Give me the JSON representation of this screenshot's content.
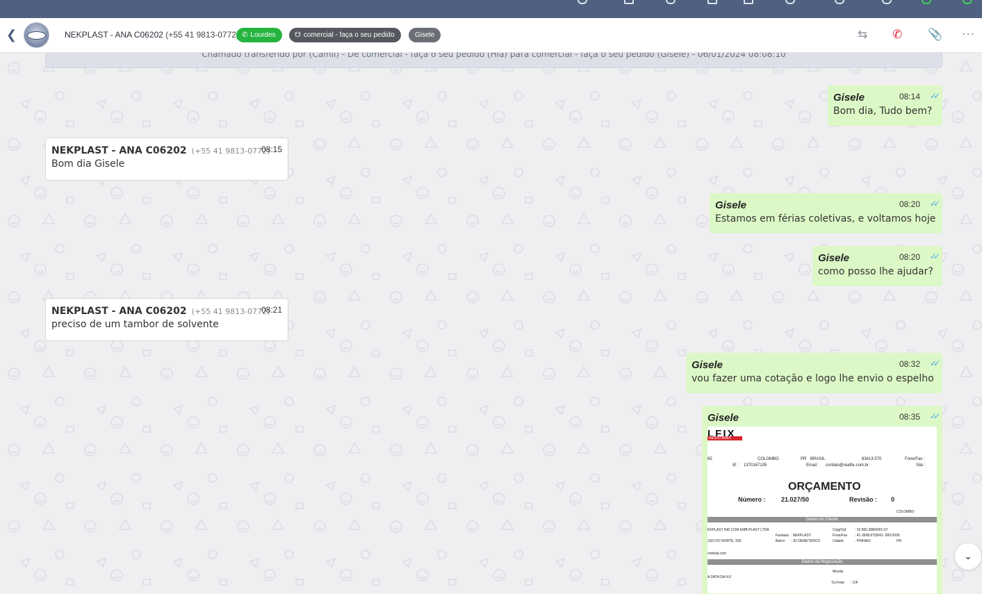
{
  "header": {
    "contact_name": "NEKPLAST - ANA C06202",
    "contact_phone": "(+55 41 9813-0772)",
    "tags": {
      "channel": "Lourdes",
      "department": "comercial - faça o seu pedido",
      "user": "Gisele"
    }
  },
  "notice": "Chamado transferido por (Camil) - De comercial - faça o seu pedido (Hia) para comercial - faça o seu pedido (Gisele) - 06/01/2024 08:08:10",
  "messages": [
    {
      "dir": "out",
      "sender": "Gisele",
      "time": "08:14",
      "text": "Bom dia, Tudo bem?"
    },
    {
      "dir": "in",
      "sender": "NEKPLAST - ANA C06202",
      "phone": "(+55 41 9813-0772)",
      "time": "08:15",
      "text": "Bom dia Gisele"
    },
    {
      "dir": "out",
      "sender": "Gisele",
      "time": "08:20",
      "text": "Estamos em férias coletivas, e voltamos hoje"
    },
    {
      "dir": "out",
      "sender": "Gisele",
      "time": "08:20",
      "text": "como posso lhe ajudar?"
    },
    {
      "dir": "in",
      "sender": "NEKPLAST - ANA C06202",
      "phone": "(+55 41 9813-0772)",
      "time": "08:21",
      "text": "preciso de um tambor de solvente"
    },
    {
      "dir": "out",
      "sender": "Gisele",
      "time": "08:32",
      "text": "vou fazer uma cotação e logo lhe envio o espelho"
    },
    {
      "dir": "out",
      "sender": "Gisele",
      "time": "08:35",
      "text": ""
    }
  ],
  "document": {
    "logo": "LFIX",
    "logo_sub": "INDUSTRIAIS",
    "l_city_num": "65",
    "city": "COLOMBO",
    "state": "PR",
    "country": "BRASIL",
    "cep": "83413.570",
    "fone_label": "Fone/Fax :",
    "ie_label": "IE :",
    "ie_value": "1370167105",
    "email_label": "Email :",
    "email_value": "contato@realfix.com.br",
    "site_label": "Site :",
    "title": "ORÇAMENTO",
    "numero_label": "Número :",
    "numero_value": "21.027/50",
    "revisao_label": "Revisão :",
    "revisao_value": "0",
    "city2": "COLOMBO",
    "sect_cliente": "Dados do Cliente",
    "client_name": "EKPLAST IND COM EMB PLAST LTDA",
    "cnpj_label": "Cnpj/Cpf",
    "cnpj_value": ": 02.860.288/0001-57",
    "fantasia_label": "Fantasia",
    "fantasia_value": ": NEKPLAST",
    "fonefax_label": "Fone/Fax",
    "fonefax_value": ": 41-3668.6758/41- 000.0000",
    "bairro_label": "Bairro",
    "bairro_value": ": JD DEMETERCO",
    "cidade_label": "Cidade",
    "cidade_value": ": PINHAIS",
    "uf_value": "PR",
    "address": "JSO DO NORTE, 935",
    "email_client": "notmail.com",
    "sect_negociacao": "Dados da Negociação",
    "moeda_label": "Moeda",
    "data_nf": "A DATA DA N.F.",
    "tpfrete_label": "Tp.Frete",
    "tpfrete_value": ": CIF"
  }
}
